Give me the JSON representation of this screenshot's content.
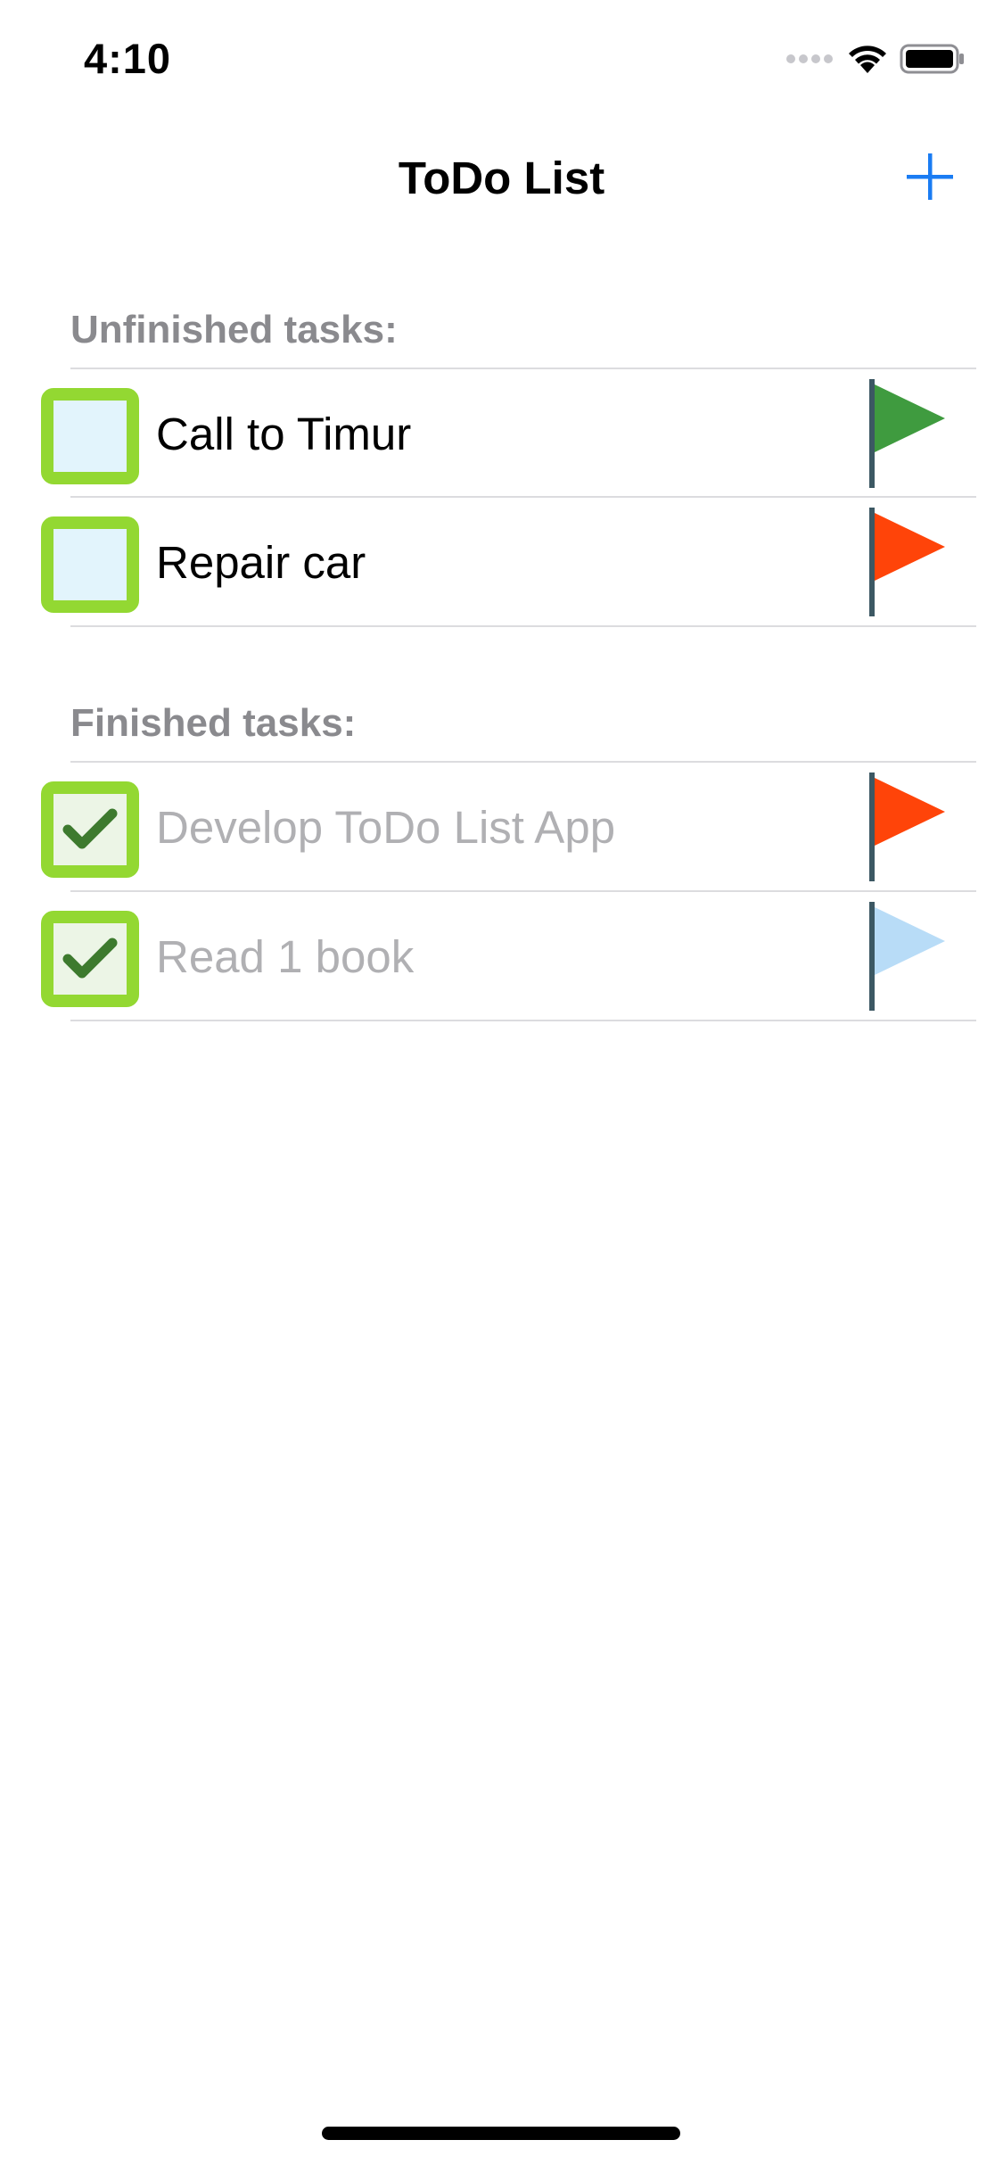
{
  "status_bar": {
    "time": "4:10",
    "icons": [
      "cellular-signal-icon",
      "wifi-icon",
      "battery-icon"
    ]
  },
  "nav": {
    "title": "ToDo List",
    "add_icon": "plus-icon",
    "accent_color": "#1a7cf3"
  },
  "sections": {
    "unfinished": {
      "header": "Unfinished tasks:",
      "tasks": [
        {
          "label": "Call to Timur",
          "checked": false,
          "flag_color": "#3f9b3f"
        },
        {
          "label": "Repair car",
          "checked": false,
          "flag_color": "#ff4409"
        }
      ]
    },
    "finished": {
      "header": "Finished tasks:",
      "tasks": [
        {
          "label": "Develop ToDo List App",
          "checked": true,
          "flag_color": "#ff4409"
        },
        {
          "label": "Read 1 book",
          "checked": true,
          "flag_color": "#b8dcf7"
        }
      ]
    }
  },
  "colors": {
    "checkbox_border": "#93d832",
    "checkmark": "#3d7a2e",
    "section_header": "#8a8a8e",
    "done_text": "#b0b0b3"
  }
}
